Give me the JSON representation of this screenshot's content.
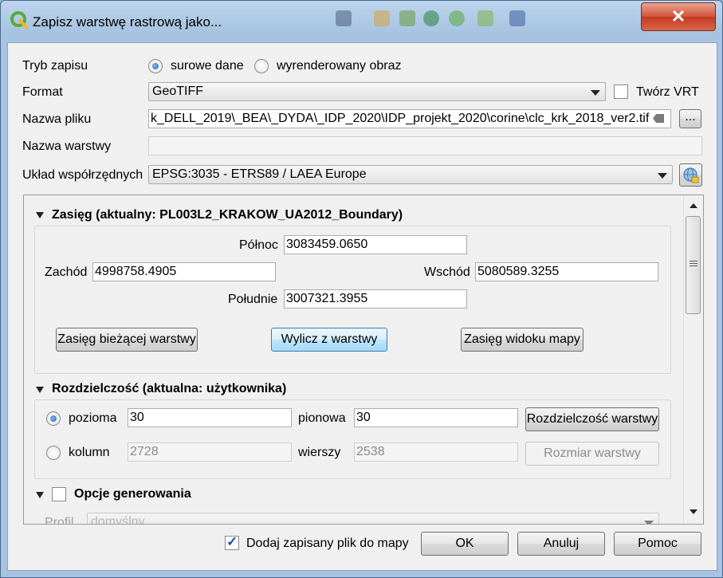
{
  "window": {
    "title": "Zapisz warstwę rastrową jako...",
    "close_label": "✕"
  },
  "tryb_zapisu": {
    "label": "Tryb zapisu",
    "option_raw": "surowe dane",
    "option_rendered": "wyrenderowany obraz",
    "selected": "surowe dane"
  },
  "format": {
    "label": "Format",
    "value": "GeoTIFF",
    "vrt_label": "Twórz VRT",
    "vrt_checked": false
  },
  "nazwa_pliku": {
    "label": "Nazwa pliku",
    "value": "k_DELL_2019\\_BEA\\_DYDA\\_IDP_2020\\IDP_projekt_2020\\corine\\clc_krk_2018_ver2.tif",
    "browse_label": "..."
  },
  "nazwa_warstwy": {
    "label": "Nazwa warstwy",
    "value": ""
  },
  "uklad": {
    "label": "Układ współrzędnych",
    "value": "EPSG:3035 - ETRS89 / LAEA Europe"
  },
  "zasieg": {
    "title": "Zasięg (aktualny: PL003L2_KRAKOW_UA2012_Boundary)",
    "polnoc_label": "Północ",
    "polnoc_value": "3083459.0650",
    "zachod_label": "Zachód",
    "zachod_value": "4998758.4905",
    "wschod_label": "Wschód",
    "wschod_value": "5080589.3255",
    "poludnie_label": "Południe",
    "poludnie_value": "3007321.3955",
    "btn_current": "Zasięg bieżącej warstwy",
    "btn_calc": "Wylicz z warstwy",
    "btn_map": "Zasięg widoku mapy"
  },
  "rozdzielczosc": {
    "title": "Rozdzielczość (aktualna: użytkownika)",
    "pozioma_label": "pozioma",
    "pozioma_value": "30",
    "pionowa_label": "pionowa",
    "pionowa_value": "30",
    "btn_res": "Rozdzielczość warstwy",
    "kolumn_label": "kolumn",
    "kolumn_value": "2728",
    "wierszy_label": "wierszy",
    "wierszy_value": "2538",
    "btn_size": "Rozmiar warstwy",
    "selected": "pozioma"
  },
  "opcje": {
    "title": "Opcje generowania",
    "checked": false,
    "profil_label": "Profil",
    "profil_value": "domyślny"
  },
  "footer": {
    "add_label": "Dodaj zapisany plik do mapy",
    "add_checked": true,
    "ok": "OK",
    "cancel": "Anuluj",
    "help": "Pomoc"
  },
  "colors": {
    "accent": "#3c7fb1",
    "close": "#c23a20"
  }
}
